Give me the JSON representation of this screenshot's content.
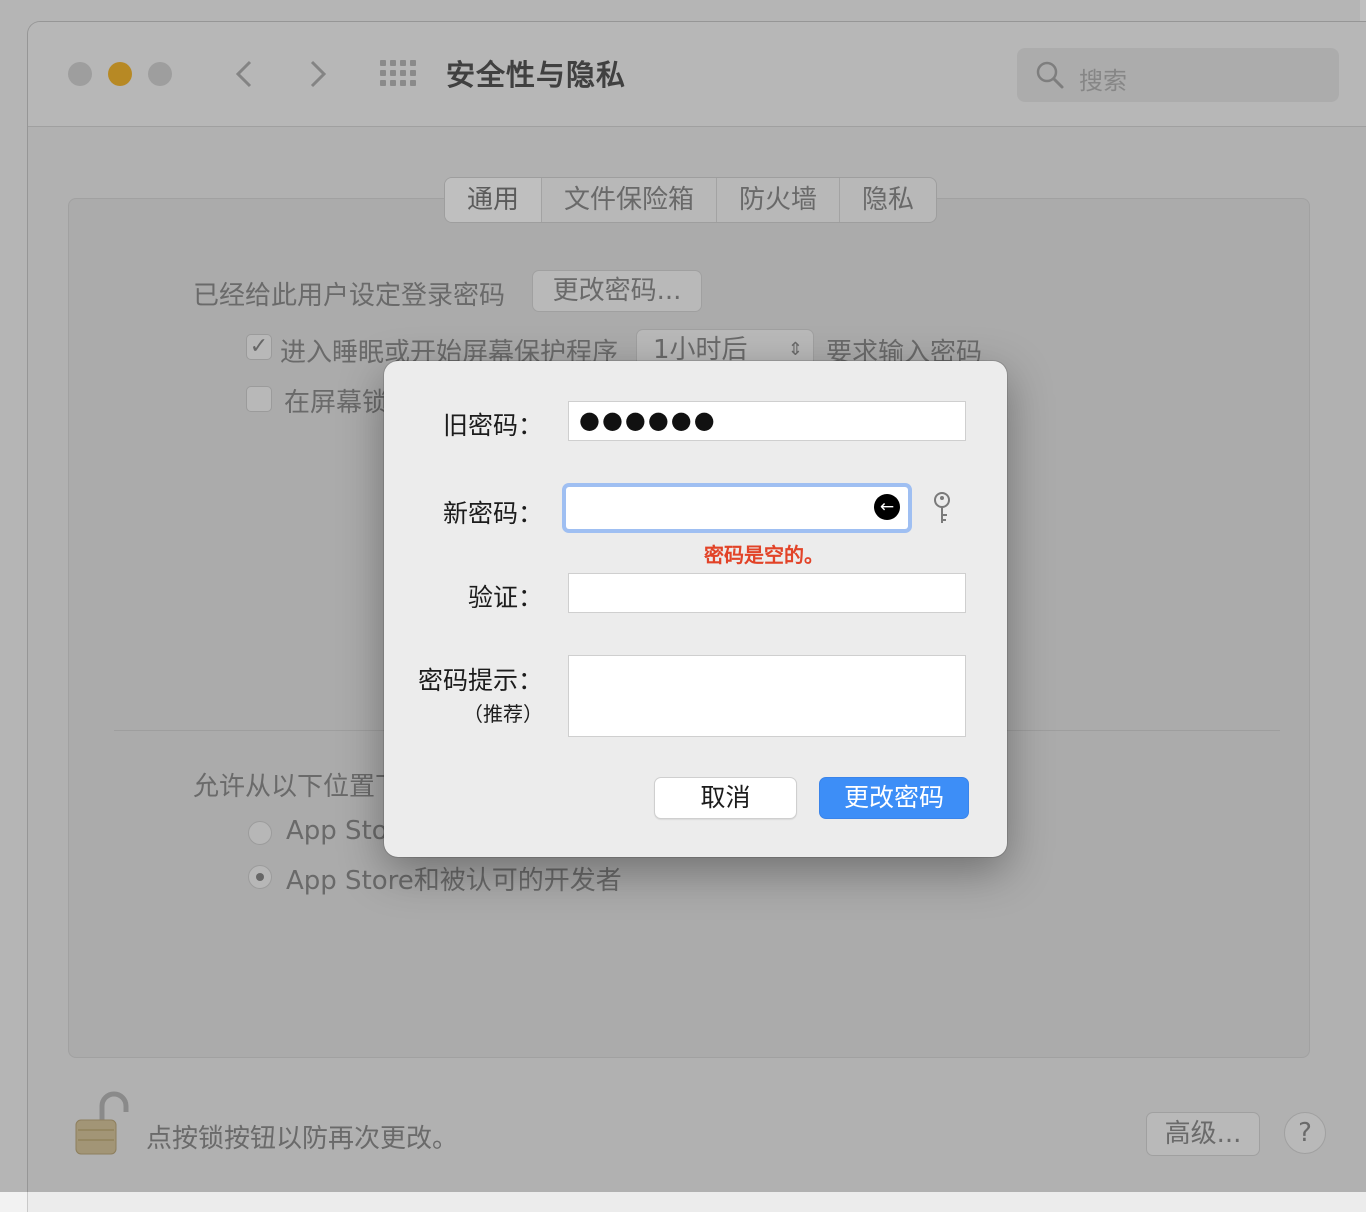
{
  "window": {
    "title": "安全性与隐私",
    "search_placeholder": "搜索",
    "traffic_colors": [
      "#d3d3d3",
      "#f5b731",
      "#d3d3d3"
    ]
  },
  "tabs": [
    {
      "label": "通用",
      "active": true
    },
    {
      "label": "文件保险箱",
      "active": false
    },
    {
      "label": "防火墙",
      "active": false
    },
    {
      "label": "隐私",
      "active": false
    }
  ],
  "general": {
    "login_password_text": "已经给此用户设定登录密码",
    "change_password_btn": "更改密码...",
    "sleep_check_label": "进入睡眠或开始屏幕保护程序",
    "sleep_select_value": "1小时后",
    "require_password_text": "要求输入密码",
    "lock_screen_label": "在屏幕锁",
    "allow_from_label": "允许从以下位置下",
    "option_appstore": "App Store",
    "option_appstore_dev": "App Store和被认可的开发者"
  },
  "footer": {
    "lock_text": "点按锁按钮以防再次更改。",
    "advanced_btn": "高级...",
    "help_btn": "?"
  },
  "dialog": {
    "old_label": "旧密码：",
    "old_value": "●●●●●●",
    "new_label": "新密码：",
    "error_text": "密码是空的。",
    "verify_label": "验证：",
    "hint_label": "密码提示：",
    "hint_sub": "（推荐）",
    "cancel_btn": "取消",
    "submit_btn": "更改密码",
    "accent": "#3d8ef7",
    "error_color": "#e24328"
  }
}
